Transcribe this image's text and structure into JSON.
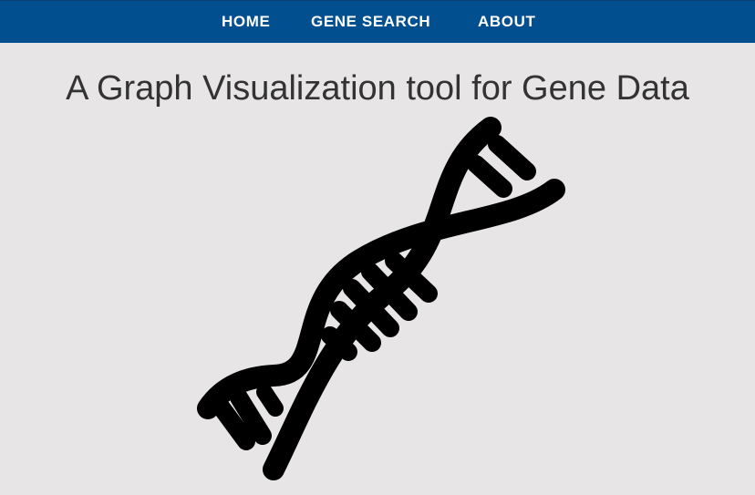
{
  "nav": {
    "items": [
      {
        "label": "HOME"
      },
      {
        "label": "GENE SEARCH"
      },
      {
        "label": "ABOUT"
      }
    ],
    "background": "#014f8f"
  },
  "main": {
    "title": "A Graph Visualization tool for Gene Data"
  },
  "hero_image": {
    "icon": "dna-helix-icon",
    "color": "#000000"
  }
}
